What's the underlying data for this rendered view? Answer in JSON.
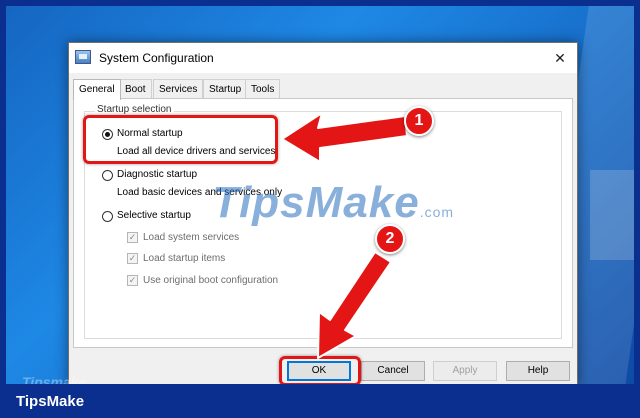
{
  "window": {
    "title": "System Configuration",
    "close_glyph": "✕"
  },
  "tabs": [
    {
      "label": "General",
      "active": true
    },
    {
      "label": "Boot",
      "active": false
    },
    {
      "label": "Services",
      "active": false
    },
    {
      "label": "Startup",
      "active": false
    },
    {
      "label": "Tools",
      "active": false
    }
  ],
  "startup_selection": {
    "group_label": "Startup selection",
    "normal": {
      "label": "Normal startup",
      "description": "Load all device drivers and services",
      "selected": true
    },
    "diagnostic": {
      "label": "Diagnostic startup",
      "description": "Load basic devices and services only",
      "selected": false
    },
    "selective": {
      "label": "Selective startup",
      "selected": false,
      "options": [
        {
          "label": "Load system services",
          "checked": true
        },
        {
          "label": "Load startup items",
          "checked": true
        },
        {
          "label": "Use original boot configuration",
          "checked": true
        }
      ]
    }
  },
  "buttons": {
    "ok": "OK",
    "cancel": "Cancel",
    "apply": "Apply",
    "help": "Help"
  },
  "annotations": {
    "step1": "1",
    "step2": "2",
    "highlight_color": "#e41515"
  },
  "watermark": {
    "text": "TipsMake",
    "suffix": ".com"
  },
  "footer": {
    "brand": "TipsMake",
    "faded_brand": "Tipsmake"
  },
  "colors": {
    "desktop_accent": "#1e88e5",
    "frame": "#0b2f8f"
  }
}
